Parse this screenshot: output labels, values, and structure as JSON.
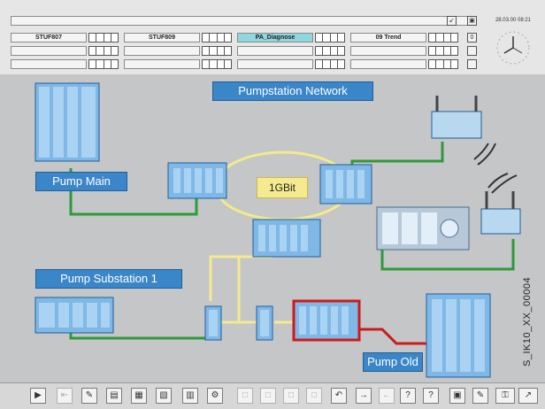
{
  "header": {
    "datetime": "28.03.00 08:21",
    "tabs": [
      {
        "label": "STUF807"
      },
      {
        "label": "STUF809"
      },
      {
        "label": "PA_Diagnose"
      },
      {
        "label": "09 Trend"
      }
    ]
  },
  "diagram": {
    "title": "Pumpstation Network",
    "ring_label": "1GBit",
    "labels": {
      "pump_main": "Pump Main",
      "pump_substation": "Pump Substation 1",
      "pump_old": "Pump Old"
    },
    "side_code": "S_IK10_XX_00004"
  },
  "colors": {
    "label_blue": "#3b86c9",
    "green_link": "#2e9a3a",
    "red_link": "#cc1b1b",
    "yellow_link": "#f5ea8f",
    "ring": "#f3ea8a"
  },
  "toolbar": {
    "icons": [
      {
        "name": "play-icon"
      },
      {
        "name": "disabled-icon-1"
      },
      {
        "name": "note-icon"
      },
      {
        "name": "save-icon"
      },
      {
        "name": "window-icon"
      },
      {
        "name": "copy-icon"
      },
      {
        "name": "settings-icon"
      },
      {
        "name": "disabled-icon-2"
      },
      {
        "name": "disabled-icon-3"
      },
      {
        "name": "disabled-icon-4"
      },
      {
        "name": "disabled-icon-5"
      },
      {
        "name": "undo-icon"
      },
      {
        "name": "forward-icon"
      },
      {
        "name": "back-icon"
      },
      {
        "name": "help-icon"
      },
      {
        "name": "help-2-icon"
      },
      {
        "name": "monitor-icon"
      },
      {
        "name": "edit-icon"
      },
      {
        "name": "key-icon"
      },
      {
        "name": "network-icon"
      }
    ]
  }
}
